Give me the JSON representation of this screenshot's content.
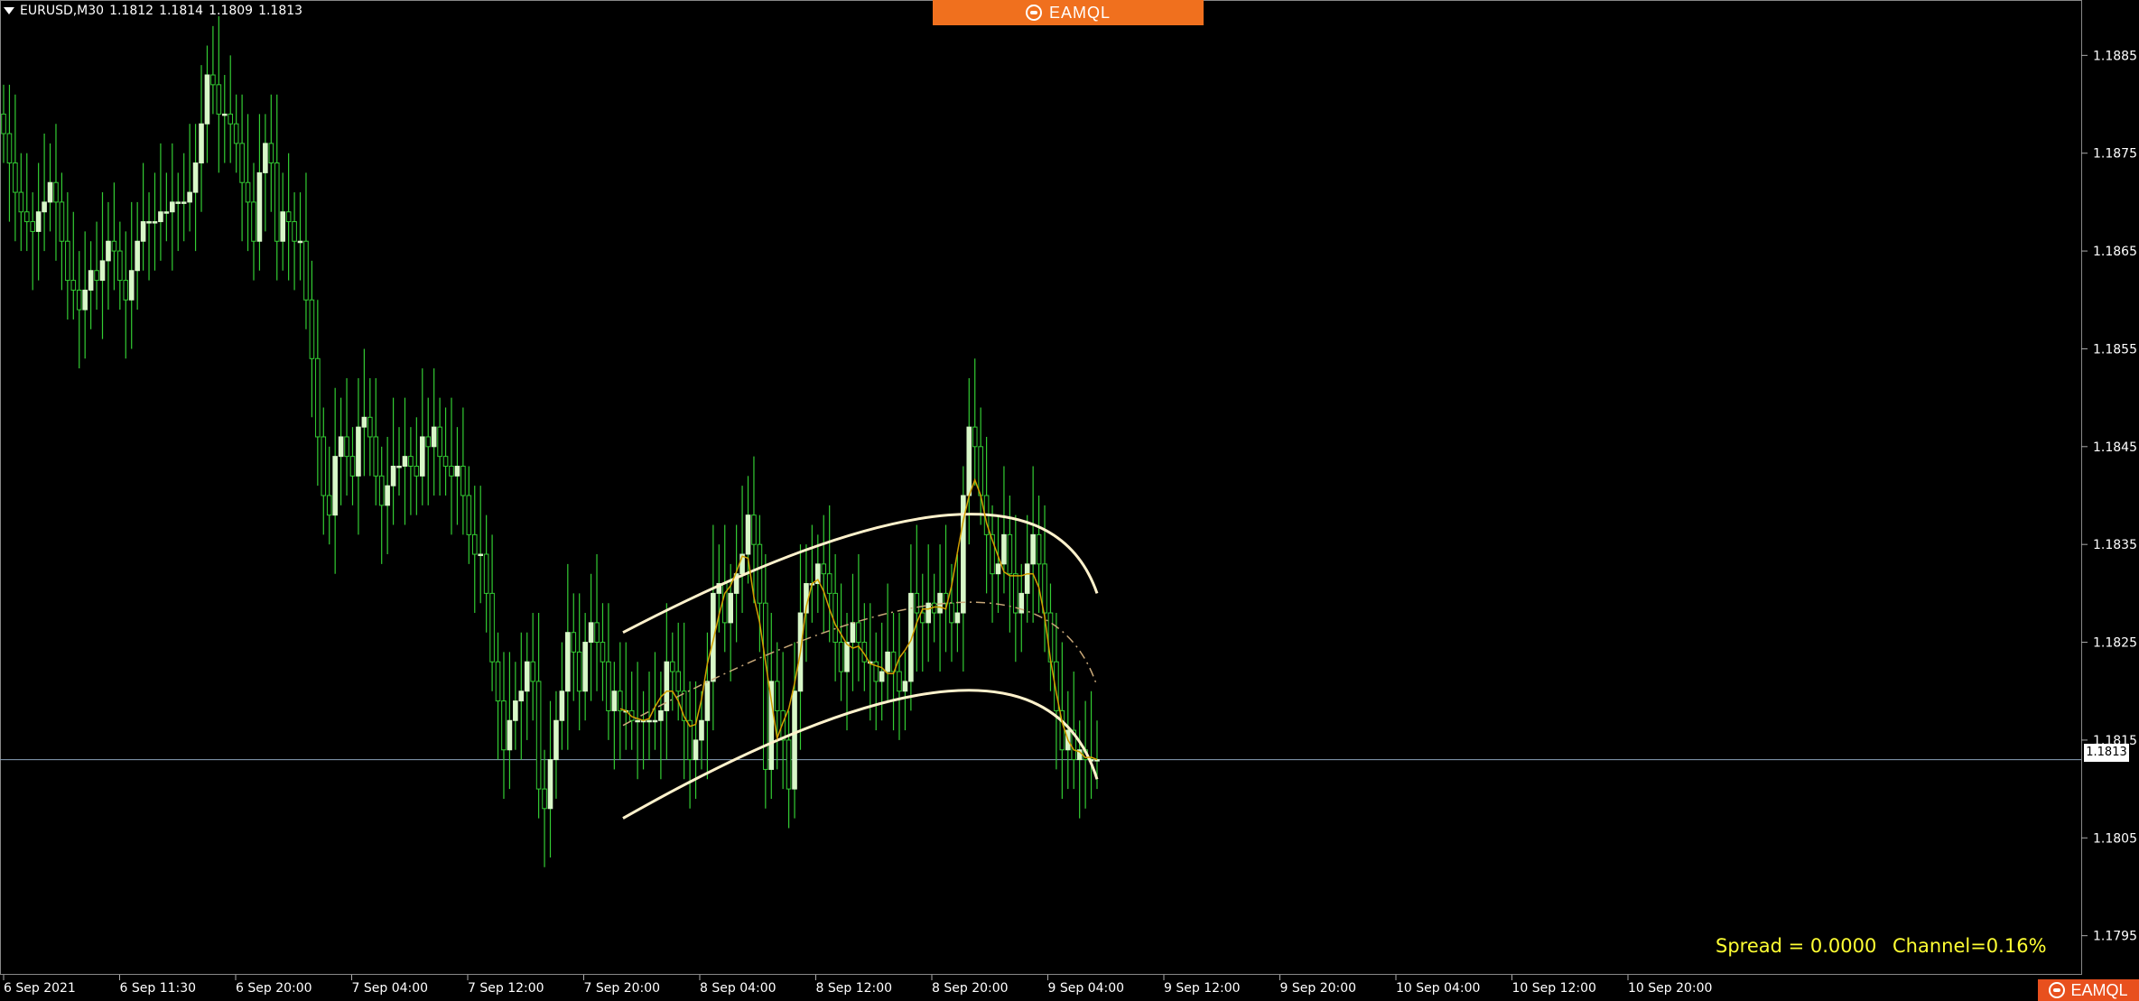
{
  "header": {
    "symbol": "EURUSD,M30",
    "open": "1.1812",
    "high": "1.1814",
    "low": "1.1809",
    "close": "1.1813"
  },
  "brand": {
    "name": "EAMQL"
  },
  "info": {
    "spread": "Spread = 0.0000",
    "channel": "Channel=0.16%"
  },
  "current_price_label": "1.1813",
  "colors": {
    "background": "#000000",
    "bull_candle": "#d8f7c8",
    "bear_candle": "#33cc33",
    "wick": "#33cc33",
    "channel": "#fff2cc",
    "fast_ma": "#d2a000",
    "mid_dash": "#c8a878",
    "brand": "#f0701e",
    "info_text": "#ffff33"
  },
  "chart_data": {
    "type": "candlestick",
    "title": "EURUSD,M30",
    "ylim": [
      1.1791,
      1.1889
    ],
    "y_ticks": [
      "1.1885",
      "1.1875",
      "1.1865",
      "1.1855",
      "1.1845",
      "1.1835",
      "1.1825",
      "1.1815",
      "1.1805",
      "1.1795"
    ],
    "x_ticks": [
      "6 Sep 2021",
      "6 Sep 11:30",
      "6 Sep 20:00",
      "7 Sep 04:00",
      "7 Sep 12:00",
      "7 Sep 20:00",
      "8 Sep 04:00",
      "8 Sep 12:00",
      "8 Sep 20:00",
      "9 Sep 04:00",
      "9 Sep 12:00",
      "9 Sep 20:00",
      "10 Sep 04:00",
      "10 Sep 12:00",
      "10 Sep 20:00"
    ],
    "current_price": 1.1813,
    "close_prices": [
      1.1877,
      1.1874,
      1.1871,
      1.1869,
      1.1868,
      1.1867,
      1.1869,
      1.187,
      1.1872,
      1.187,
      1.1866,
      1.1862,
      1.1861,
      1.1859,
      1.1861,
      1.1863,
      1.1862,
      1.1864,
      1.1866,
      1.1865,
      1.1862,
      1.186,
      1.1863,
      1.1866,
      1.1868,
      1.1868,
      1.1868,
      1.1869,
      1.1869,
      1.187,
      1.187,
      1.187,
      1.1871,
      1.1874,
      1.1878,
      1.1883,
      1.1882,
      1.1879,
      1.1879,
      1.1878,
      1.1876,
      1.1872,
      1.187,
      1.1866,
      1.1873,
      1.1876,
      1.1874,
      1.1866,
      1.1869,
      1.1868,
      1.1866,
      1.1866,
      1.186,
      1.1854,
      1.1846,
      1.184,
      1.1838,
      1.1844,
      1.1846,
      1.1844,
      1.1842,
      1.1847,
      1.1848,
      1.1846,
      1.1842,
      1.1839,
      1.1841,
      1.1843,
      1.1843,
      1.1844,
      1.1843,
      1.1842,
      1.1846,
      1.1845,
      1.1847,
      1.1844,
      1.1843,
      1.1842,
      1.1843,
      1.184,
      1.1836,
      1.1834,
      1.1834,
      1.183,
      1.1823,
      1.1819,
      1.1814,
      1.1817,
      1.1819,
      1.182,
      1.1823,
      1.1821,
      1.181,
      1.1808,
      1.1813,
      1.1817,
      1.182,
      1.1826,
      1.1824,
      1.182,
      1.1825,
      1.1827,
      1.1825,
      1.1823,
      1.1818,
      1.182,
      1.1818,
      1.1818,
      1.1817,
      1.1817,
      1.1817,
      1.1817,
      1.1817,
      1.1818,
      1.1823,
      1.1822,
      1.182,
      1.1817,
      1.1813,
      1.1815,
      1.1817,
      1.1821,
      1.183,
      1.1831,
      1.1827,
      1.183,
      1.1832,
      1.1834,
      1.1838,
      1.1835,
      1.1829,
      1.1812,
      1.1821,
      1.1818,
      1.1815,
      1.181,
      1.182,
      1.1828,
      1.1831,
      1.1831,
      1.1833,
      1.1832,
      1.183,
      1.1825,
      1.1822,
      1.1825,
      1.1827,
      1.1825,
      1.1823,
      1.1823,
      1.1821,
      1.1822,
      1.1824,
      1.1822,
      1.182,
      1.1821,
      1.183,
      1.1828,
      1.1827,
      1.1829,
      1.1828,
      1.183,
      1.1829,
      1.1827,
      1.1828,
      1.184,
      1.1847,
      1.1845,
      1.184,
      1.1836,
      1.1832,
      1.1833,
      1.1836,
      1.1832,
      1.1828,
      1.183,
      1.1833,
      1.1836,
      1.1833,
      1.1828,
      1.1823,
      1.1818,
      1.1814,
      1.1816,
      1.1813,
      1.1814,
      1.1813,
      1.1813,
      1.1813
    ],
    "channel_upper": [
      [
        690,
        1.1826
      ],
      [
        1050,
        1.1838
      ],
      [
        1215,
        1.183
      ]
    ],
    "channel_lower": [
      [
        690,
        1.1807
      ],
      [
        1050,
        1.182
      ],
      [
        1215,
        1.1811
      ]
    ]
  }
}
